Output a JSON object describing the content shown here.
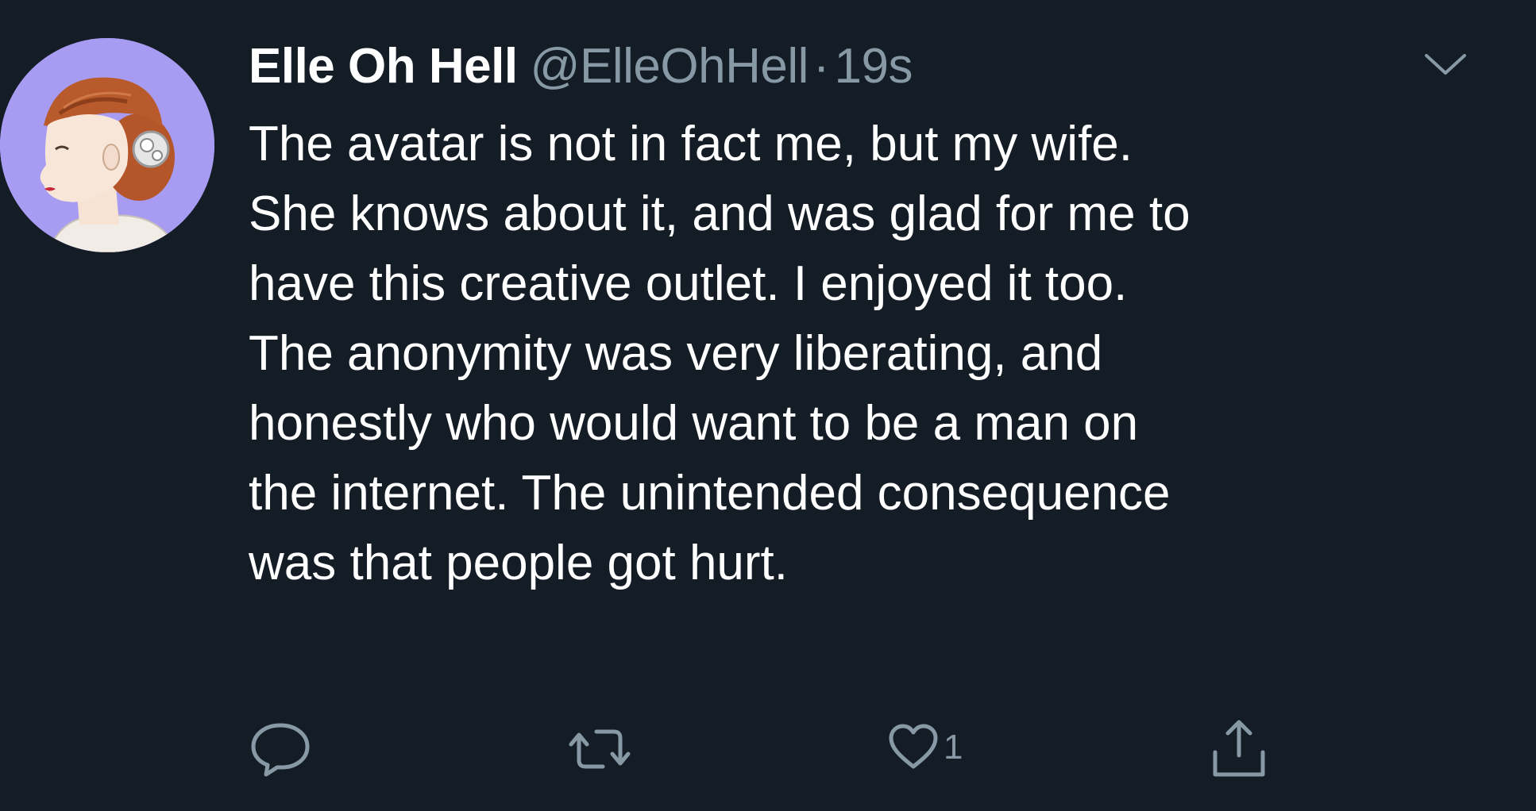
{
  "tweet": {
    "display_name": "Elle Oh Hell",
    "handle": "@ElleOhHell",
    "separator": "·",
    "time": "19s",
    "text_lines": [
      "The avatar is not in fact me, but my wife.",
      "She knows about it, and was glad for me to",
      "have this creative outlet. I enjoyed it too.",
      "The anonymity was very liberating, and",
      "honestly who would want to be a man on",
      "the internet. The unintended consequence",
      "was that people got hurt."
    ]
  },
  "actions": {
    "reply_icon": "reply-icon",
    "retweet_icon": "retweet-icon",
    "like_icon": "heart-icon",
    "like_count": "1",
    "share_icon": "share-icon"
  },
  "colors": {
    "background": "#141d26",
    "text_primary": "#ffffff",
    "text_secondary": "#8899a6",
    "avatar_background": "#a89cf2"
  }
}
